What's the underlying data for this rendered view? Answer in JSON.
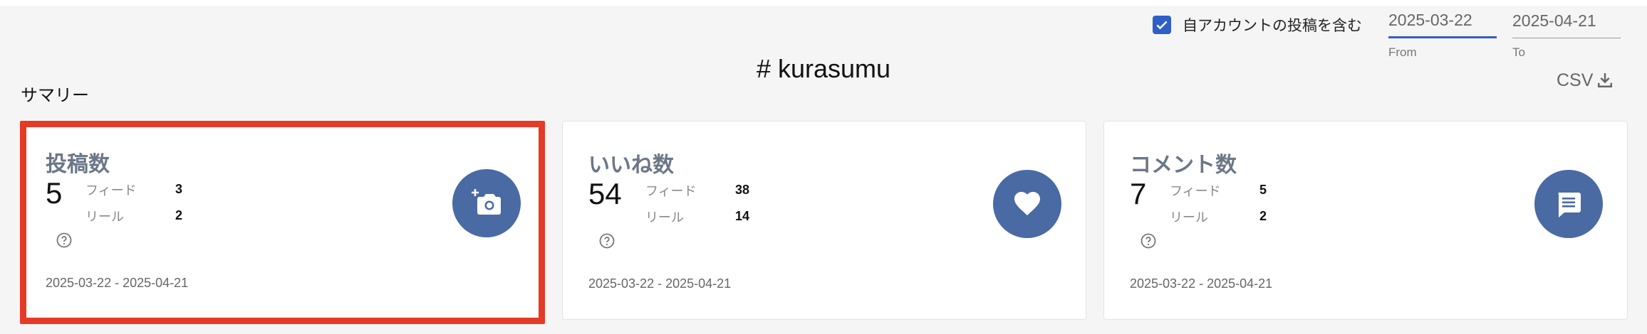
{
  "filters": {
    "include_own_account": {
      "checked": true,
      "label": "自アカウントの投稿を含む"
    },
    "from": {
      "value": "2025-03-22",
      "label": "From"
    },
    "to": {
      "value": "2025-04-21",
      "label": "To"
    }
  },
  "page_title": "# kurasumu",
  "summary_label": "サマリー",
  "csv_label": "CSV",
  "cards": [
    {
      "title": "投稿数",
      "total": "5",
      "breakdown": [
        {
          "label": "フィード",
          "value": "3"
        },
        {
          "label": "リール",
          "value": "2"
        }
      ],
      "period": "2025-03-22 - 2025-04-21",
      "icon": "add-photo-icon",
      "selected": true
    },
    {
      "title": "いいね数",
      "total": "54",
      "breakdown": [
        {
          "label": "フィード",
          "value": "38"
        },
        {
          "label": "リール",
          "value": "14"
        }
      ],
      "period": "2025-03-22 - 2025-04-21",
      "icon": "heart-icon",
      "selected": false
    },
    {
      "title": "コメント数",
      "total": "7",
      "breakdown": [
        {
          "label": "フィード",
          "value": "5"
        },
        {
          "label": "リール",
          "value": "2"
        }
      ],
      "period": "2025-03-22 - 2025-04-21",
      "icon": "comment-icon",
      "selected": false
    }
  ],
  "colors": {
    "accent": "#2f5fc4",
    "icon_bg": "#4a6aa3",
    "selection_border": "#e53b26",
    "card_title": "#6b7787"
  }
}
